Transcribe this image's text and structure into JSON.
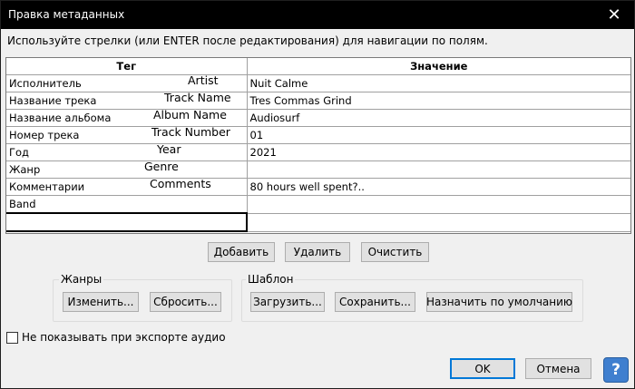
{
  "window": {
    "title": "Правка метаданных",
    "close_glyph": "✕"
  },
  "instructions": "Используйте стрелки (или ENTER после редактирования) для навигации по полям.",
  "table": {
    "headers": {
      "tag": "Тег",
      "value": "Значение"
    },
    "rows": [
      {
        "tag_ru": "Исполнитель",
        "tag_en": "Artist",
        "value": "Nuit Calme"
      },
      {
        "tag_ru": "Название трека",
        "tag_en": "Track Name",
        "value": "Tres Commas Grind"
      },
      {
        "tag_ru": "Название альбома",
        "tag_en": "Album Name",
        "value": "Audiosurf"
      },
      {
        "tag_ru": "Номер трека",
        "tag_en": "Track Number",
        "value": "01"
      },
      {
        "tag_ru": "Год",
        "tag_en": "Year",
        "value": "2021"
      },
      {
        "tag_ru": "Жанр",
        "tag_en": "Genre",
        "value": ""
      },
      {
        "tag_ru": "Комментарии",
        "tag_en": "Comments",
        "value": "80 hours well spent?.."
      },
      {
        "tag_ru": "Band",
        "tag_en": "",
        "value": ""
      }
    ],
    "edit_row_value": ""
  },
  "row_buttons": {
    "add": "Добавить",
    "remove": "Удалить",
    "clear": "Очистить"
  },
  "genres": {
    "label": "Жанры",
    "edit": "Изменить...",
    "reset": "Сбросить..."
  },
  "template": {
    "label": "Шаблон",
    "load": "Загрузить...",
    "save": "Сохранить...",
    "set_default": "Назначить по умолчанию"
  },
  "dont_show": {
    "label": "Не показывать при экспорте аудио",
    "checked": false
  },
  "footer": {
    "ok": "OK",
    "cancel": "Отмена",
    "help_glyph": "?"
  },
  "colors": {
    "titlebar": "#000000",
    "focus": "#0078d7",
    "help": "#3f7fcf"
  },
  "icons": {
    "close": "close-icon",
    "help": "help-icon"
  }
}
